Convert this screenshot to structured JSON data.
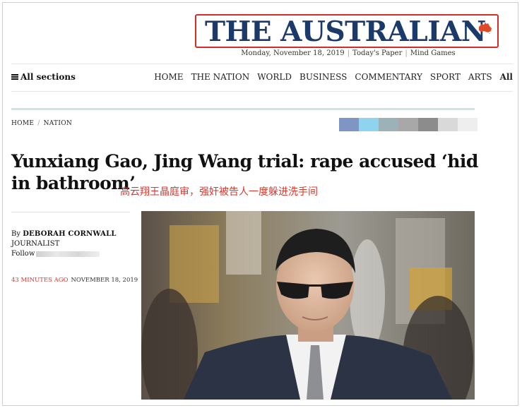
{
  "masthead": {
    "title": "THE AUSTRALIAN",
    "date": "Monday, November 18, 2019",
    "links": [
      "Today's Paper",
      "Mind Games"
    ]
  },
  "nav": {
    "all_sections": "All sections",
    "items": [
      "HOME",
      "THE NATION",
      "WORLD",
      "BUSINESS",
      "COMMENTARY",
      "SPORT",
      "ARTS",
      "All"
    ]
  },
  "breadcrumb": [
    "HOME",
    "NATION"
  ],
  "article": {
    "headline": "Yunxiang Gao, Jing Wang trial: rape accused ‘hid in bathroom’",
    "translation": "高云翔王晶庭审，强奸被告人一度躲进洗手间",
    "byline_prefix": "By",
    "author": "DEBORAH CORNWALL",
    "role": "JOURNALIST",
    "follow": "Follow",
    "time_ago": "43 MINUTES AGO",
    "date": "NOVEMBER 18, 2019"
  },
  "colors": {
    "masthead_blue": "#1b3a6a",
    "accent_red": "#d8382d",
    "share_colors": [
      "#7f95c4",
      "#8fd3ef",
      "#9db2b8",
      "#a8a8a8",
      "#8c8c8c",
      "#d9d9d9",
      "#eeeeee"
    ]
  }
}
